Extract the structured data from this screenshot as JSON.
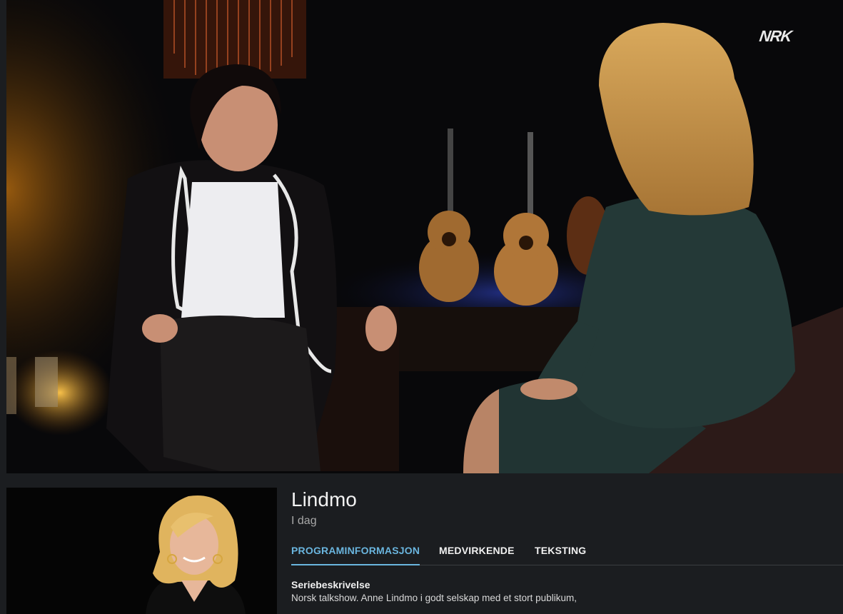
{
  "player": {
    "channel_logo": "NRK"
  },
  "program": {
    "title": "Lindmo",
    "subtitle": "I dag"
  },
  "tabs": [
    {
      "label": "PROGRAMINFORMASJON",
      "active": true
    },
    {
      "label": "MEDVIRKENDE",
      "active": false
    },
    {
      "label": "TEKSTING",
      "active": false
    }
  ],
  "description": {
    "heading": "Seriebeskrivelse",
    "text": "Norsk talkshow. Anne Lindmo i godt selskap med et stort publikum,"
  },
  "colors": {
    "accent": "#6ab5de",
    "background": "#1b1d20"
  }
}
